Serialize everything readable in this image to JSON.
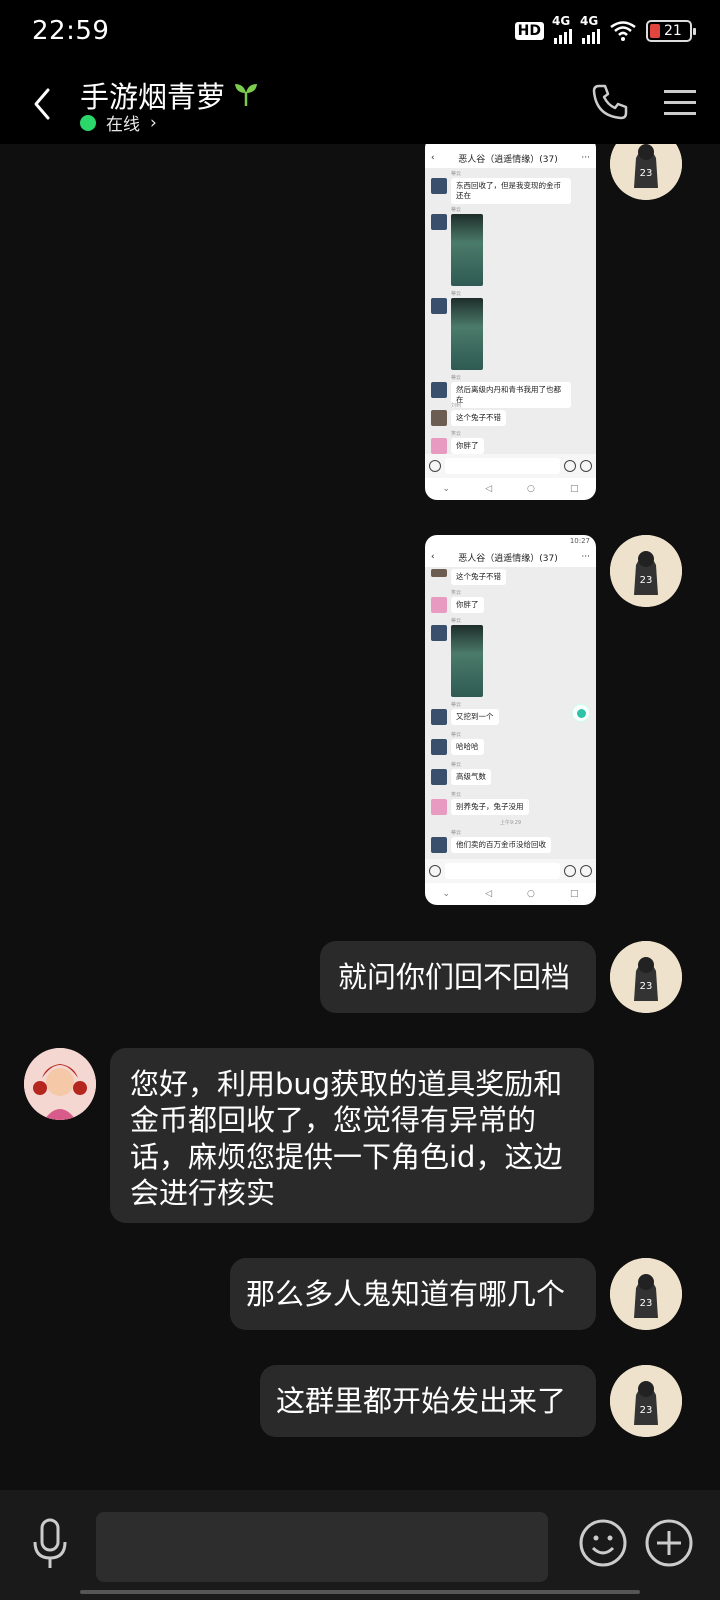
{
  "status_bar": {
    "time": "22:59",
    "hd": "HD",
    "signal1": "4G",
    "signal2": "4G",
    "battery": "21"
  },
  "header": {
    "title": "手游烟青萝",
    "status": "在线",
    "status_arrow": "›",
    "back_icon": "chevron-left-icon"
  },
  "colors": {
    "background": "#0f0f0f",
    "bubble": "#2a2a2a",
    "online": "#2bd66a"
  },
  "screenshot1": {
    "group_title": "恶人谷（逍遥情缘）(37)",
    "messages": [
      {
        "name": "蒂云",
        "text": "东西回收了，但是我变现的金币还在"
      },
      {
        "name": "蒂云",
        "image": true
      },
      {
        "name": "蒂云",
        "image": true
      },
      {
        "name": "蒂云",
        "text": "然后离级内丹和青书我用了也都在"
      },
      {
        "name": "刘刺",
        "text": "这个兔子不错"
      },
      {
        "name": "笑云",
        "text": "你胖了"
      }
    ]
  },
  "screenshot2": {
    "time": "10:27",
    "group_title": "恶人谷（逍遥情缘）(37)",
    "messages": [
      {
        "name": "",
        "text": "这个兔子不错"
      },
      {
        "name": "笑云",
        "text": "你胖了"
      },
      {
        "name": "蒂云",
        "image": true
      },
      {
        "name": "蒂云",
        "text": "又挖到一个"
      },
      {
        "name": "蒂云",
        "text": "哈哈哈"
      },
      {
        "name": "蒂云",
        "text": "高级气数"
      },
      {
        "name": "笑云",
        "text": "别养兔子，兔子没用"
      },
      {
        "name": "蒂云",
        "text": "他们卖的百万金币没给回收"
      }
    ],
    "timestamp": "上午9:29"
  },
  "messages": [
    {
      "side": "right",
      "text": "就问你们回不回档"
    },
    {
      "side": "left",
      "text": "您好，利用bug获取的道具奖励和金币都回收了，您觉得有异常的话，麻烦您提供一下角色id，这边会进行核实"
    },
    {
      "side": "right",
      "text": "那么多人鬼知道有哪几个"
    },
    {
      "side": "right",
      "text": "这群里都开始发出来了"
    }
  ],
  "input_bar": {
    "placeholder": ""
  }
}
